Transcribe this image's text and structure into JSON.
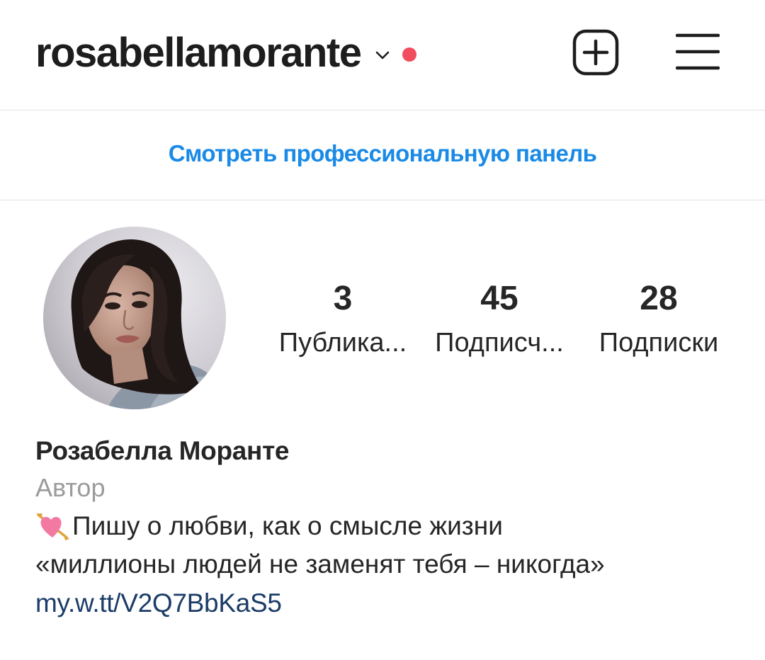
{
  "header": {
    "username": "rosabellamorante",
    "icons": {
      "account_switch": "chevron-down-icon",
      "notification": "notification-dot-icon",
      "create": "add-square-icon",
      "menu": "hamburger-menu-icon"
    }
  },
  "pro_dashboard": {
    "label": "Смотреть профессиональную панель"
  },
  "profile": {
    "avatar": "profile-photo",
    "stats": [
      {
        "count": "3",
        "label": "Публика..."
      },
      {
        "count": "45",
        "label": "Подписч..."
      },
      {
        "count": "28",
        "label": "Подписки"
      }
    ],
    "full_name": "Розабелла Моранте",
    "category": "Автор",
    "bio_icon": "heart-with-arrow-icon",
    "bio_lines": [
      "Пишу о любви, как о смысле жизни",
      "«миллионы людей не заменят тебя – никогда»"
    ],
    "link": "my.w.tt/V2Q7BbKaS5"
  },
  "colors": {
    "accent_blue": "#1a8ae6",
    "notification_red": "#f24d5f",
    "link_navy": "#1b3c68",
    "secondary_text": "#9b9b9b",
    "divider": "#e3e3e3"
  }
}
